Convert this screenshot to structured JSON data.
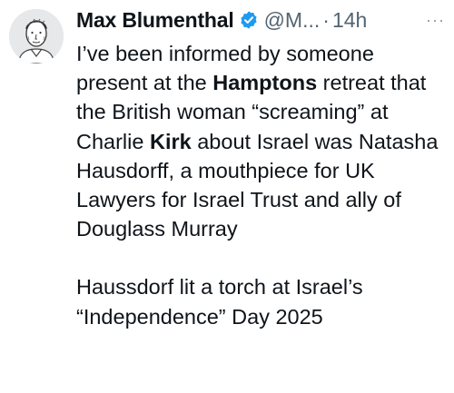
{
  "author": {
    "name": "Max Blumenthal",
    "handle": "@M...",
    "separator": "·",
    "time": "14h",
    "verified": true
  },
  "menu": {
    "icon": "more-horizontal-icon",
    "label": "···"
  },
  "tweet": {
    "p1": {
      "t1": "I’ve been informed by someone present at the ",
      "b1": "Hamptons",
      "t2": " retreat that the British woman “screaming” at Charlie ",
      "b2": "Kirk",
      "t3": " about Israel was Natasha Hausdorff, a mouthpiece for UK Lawyers for Israel Trust and ally of Douglass Murray"
    },
    "p2": "Haussdorf lit a torch at Israel’s “Independence” Day 2025"
  },
  "colors": {
    "text": "#0f1419",
    "secondary": "#536471",
    "verified": "#1d9bf0"
  }
}
